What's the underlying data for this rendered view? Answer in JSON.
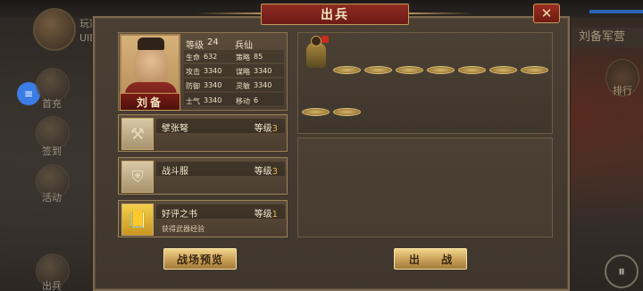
{
  "background": {
    "player_label": "玩家",
    "uid_label": "UID",
    "left_menu": [
      "首充",
      "签到",
      "活动",
      "出兵"
    ],
    "right_title": "刘备军营",
    "rank_label": "排行",
    "menu_icon": "pause-icon",
    "chat_icon": "chat-icon"
  },
  "panel": {
    "title": "出兵",
    "close_icon": "close-icon"
  },
  "general": {
    "name": "刘备",
    "level_label": "等级",
    "level": "24",
    "unit_type": "兵仙",
    "stats": {
      "hp_label": "生命",
      "hp": "632",
      "strategy_label": "策略",
      "strategy": "85",
      "attack_label": "攻击",
      "attack": "3340",
      "tactics_label": "谋略",
      "tactics": "3340",
      "defense_label": "防御",
      "defense": "3340",
      "agility_label": "灵敏",
      "agility": "3340",
      "morale_label": "士气",
      "morale": "3340",
      "move_label": "移动",
      "move": "6"
    }
  },
  "items": [
    {
      "name": "擘张弩",
      "level_label": "等级",
      "level": "3",
      "desc": "",
      "icon": "crossbow-icon"
    },
    {
      "name": "战斗服",
      "level_label": "等级",
      "level": "3",
      "desc": "",
      "icon": "armor-icon"
    },
    {
      "name": "好评之书",
      "level_label": "等级",
      "level": "1",
      "desc": "获得武器经验",
      "icon": "book-icon"
    }
  ],
  "buttons": {
    "preview": "战场预览",
    "battle": "出 战"
  },
  "colors": {
    "header_red": "#7a1f18",
    "gold": "#c9a057",
    "panel_brown": "#463c30",
    "level_highlight": "#e9b54a"
  }
}
